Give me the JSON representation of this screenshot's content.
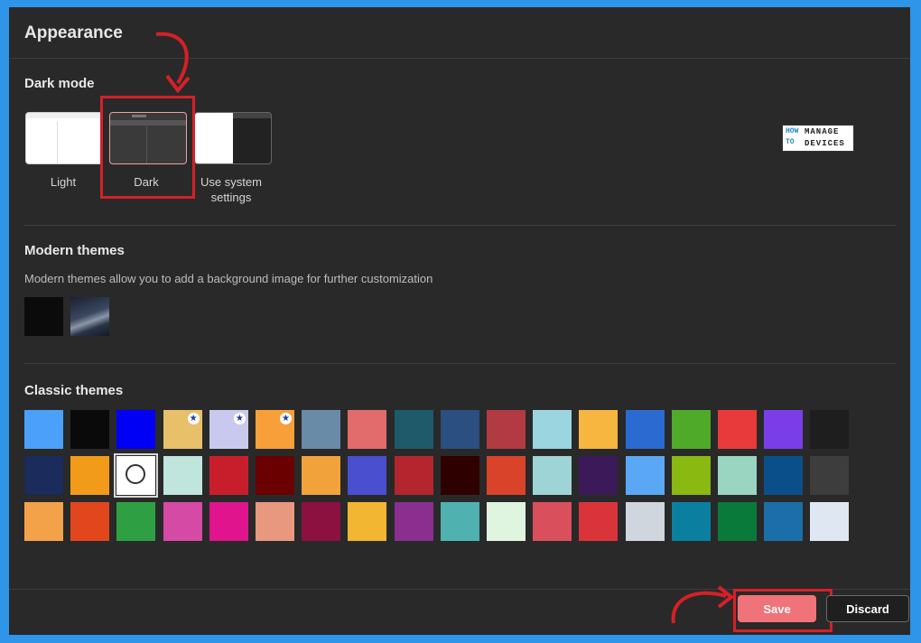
{
  "header": {
    "title": "Appearance"
  },
  "dark_mode": {
    "title": "Dark mode",
    "options": [
      {
        "label": "Light",
        "selected": false
      },
      {
        "label": "Dark",
        "selected": true
      },
      {
        "label": "Use system settings",
        "selected": false
      }
    ]
  },
  "logo": {
    "line1": "HOW",
    "line2": "TO",
    "word1": "MANAGE",
    "word2": "DEVICES"
  },
  "modern_themes": {
    "title": "Modern themes",
    "description": "Modern themes allow you to add a background image for further customization",
    "items": [
      {
        "icon": "solid-black-theme"
      },
      {
        "icon": "dark-dunes-image-theme"
      }
    ]
  },
  "classic_themes": {
    "title": "Classic themes",
    "rows": [
      [
        "#4ba0fa",
        "#0a0a0a",
        "#0000f5",
        "#e8c06a",
        "#c9c9f0",
        "#f7a03a",
        "#6a8ba8",
        "#e26b6b",
        "#1f5a6a",
        "#2a4f80",
        "#b23b43",
        "#9ad5e0",
        "#f7b640",
        "#2b6ad1",
        "#4faa2a",
        "#e83a3a",
        "#7a3ee8",
        "#1e1e1e"
      ],
      [
        "#1a2b5c",
        "#f29b1a",
        "#ffffff",
        "#bfe5dd",
        "#c81e2b",
        "#6b0000",
        "#f2a23a",
        "#4a4fcf",
        "#b3262e",
        "#2e0000",
        "#d9432a",
        "#9fd4d6",
        "#3c1a5a",
        "#5aa8f5",
        "#8ab911",
        "#9ad5c2",
        "#0b4f8a",
        "#3d3d3d"
      ],
      [
        "#f4a24a",
        "#e2461c",
        "#2ea043",
        "#d44aa5",
        "#e0148c",
        "#e8987f",
        "#8c1040",
        "#f2b632",
        "#8a2f8f",
        "#4fb2b0",
        "#dff5e0",
        "#d9505c",
        "#d9343a",
        "#d0d6de",
        "#0a7fa0",
        "#0a7a3a",
        "#1b6ea8",
        "#dfe8f2"
      ]
    ],
    "star_badges": [
      [
        0,
        3
      ],
      [
        0,
        4
      ],
      [
        0,
        5
      ]
    ],
    "selected": [
      1,
      2
    ]
  },
  "actions": {
    "save_label": "Save",
    "discard_label": "Discard"
  },
  "colors": {
    "accent": "#f0737a",
    "annotation": "#d62027"
  }
}
